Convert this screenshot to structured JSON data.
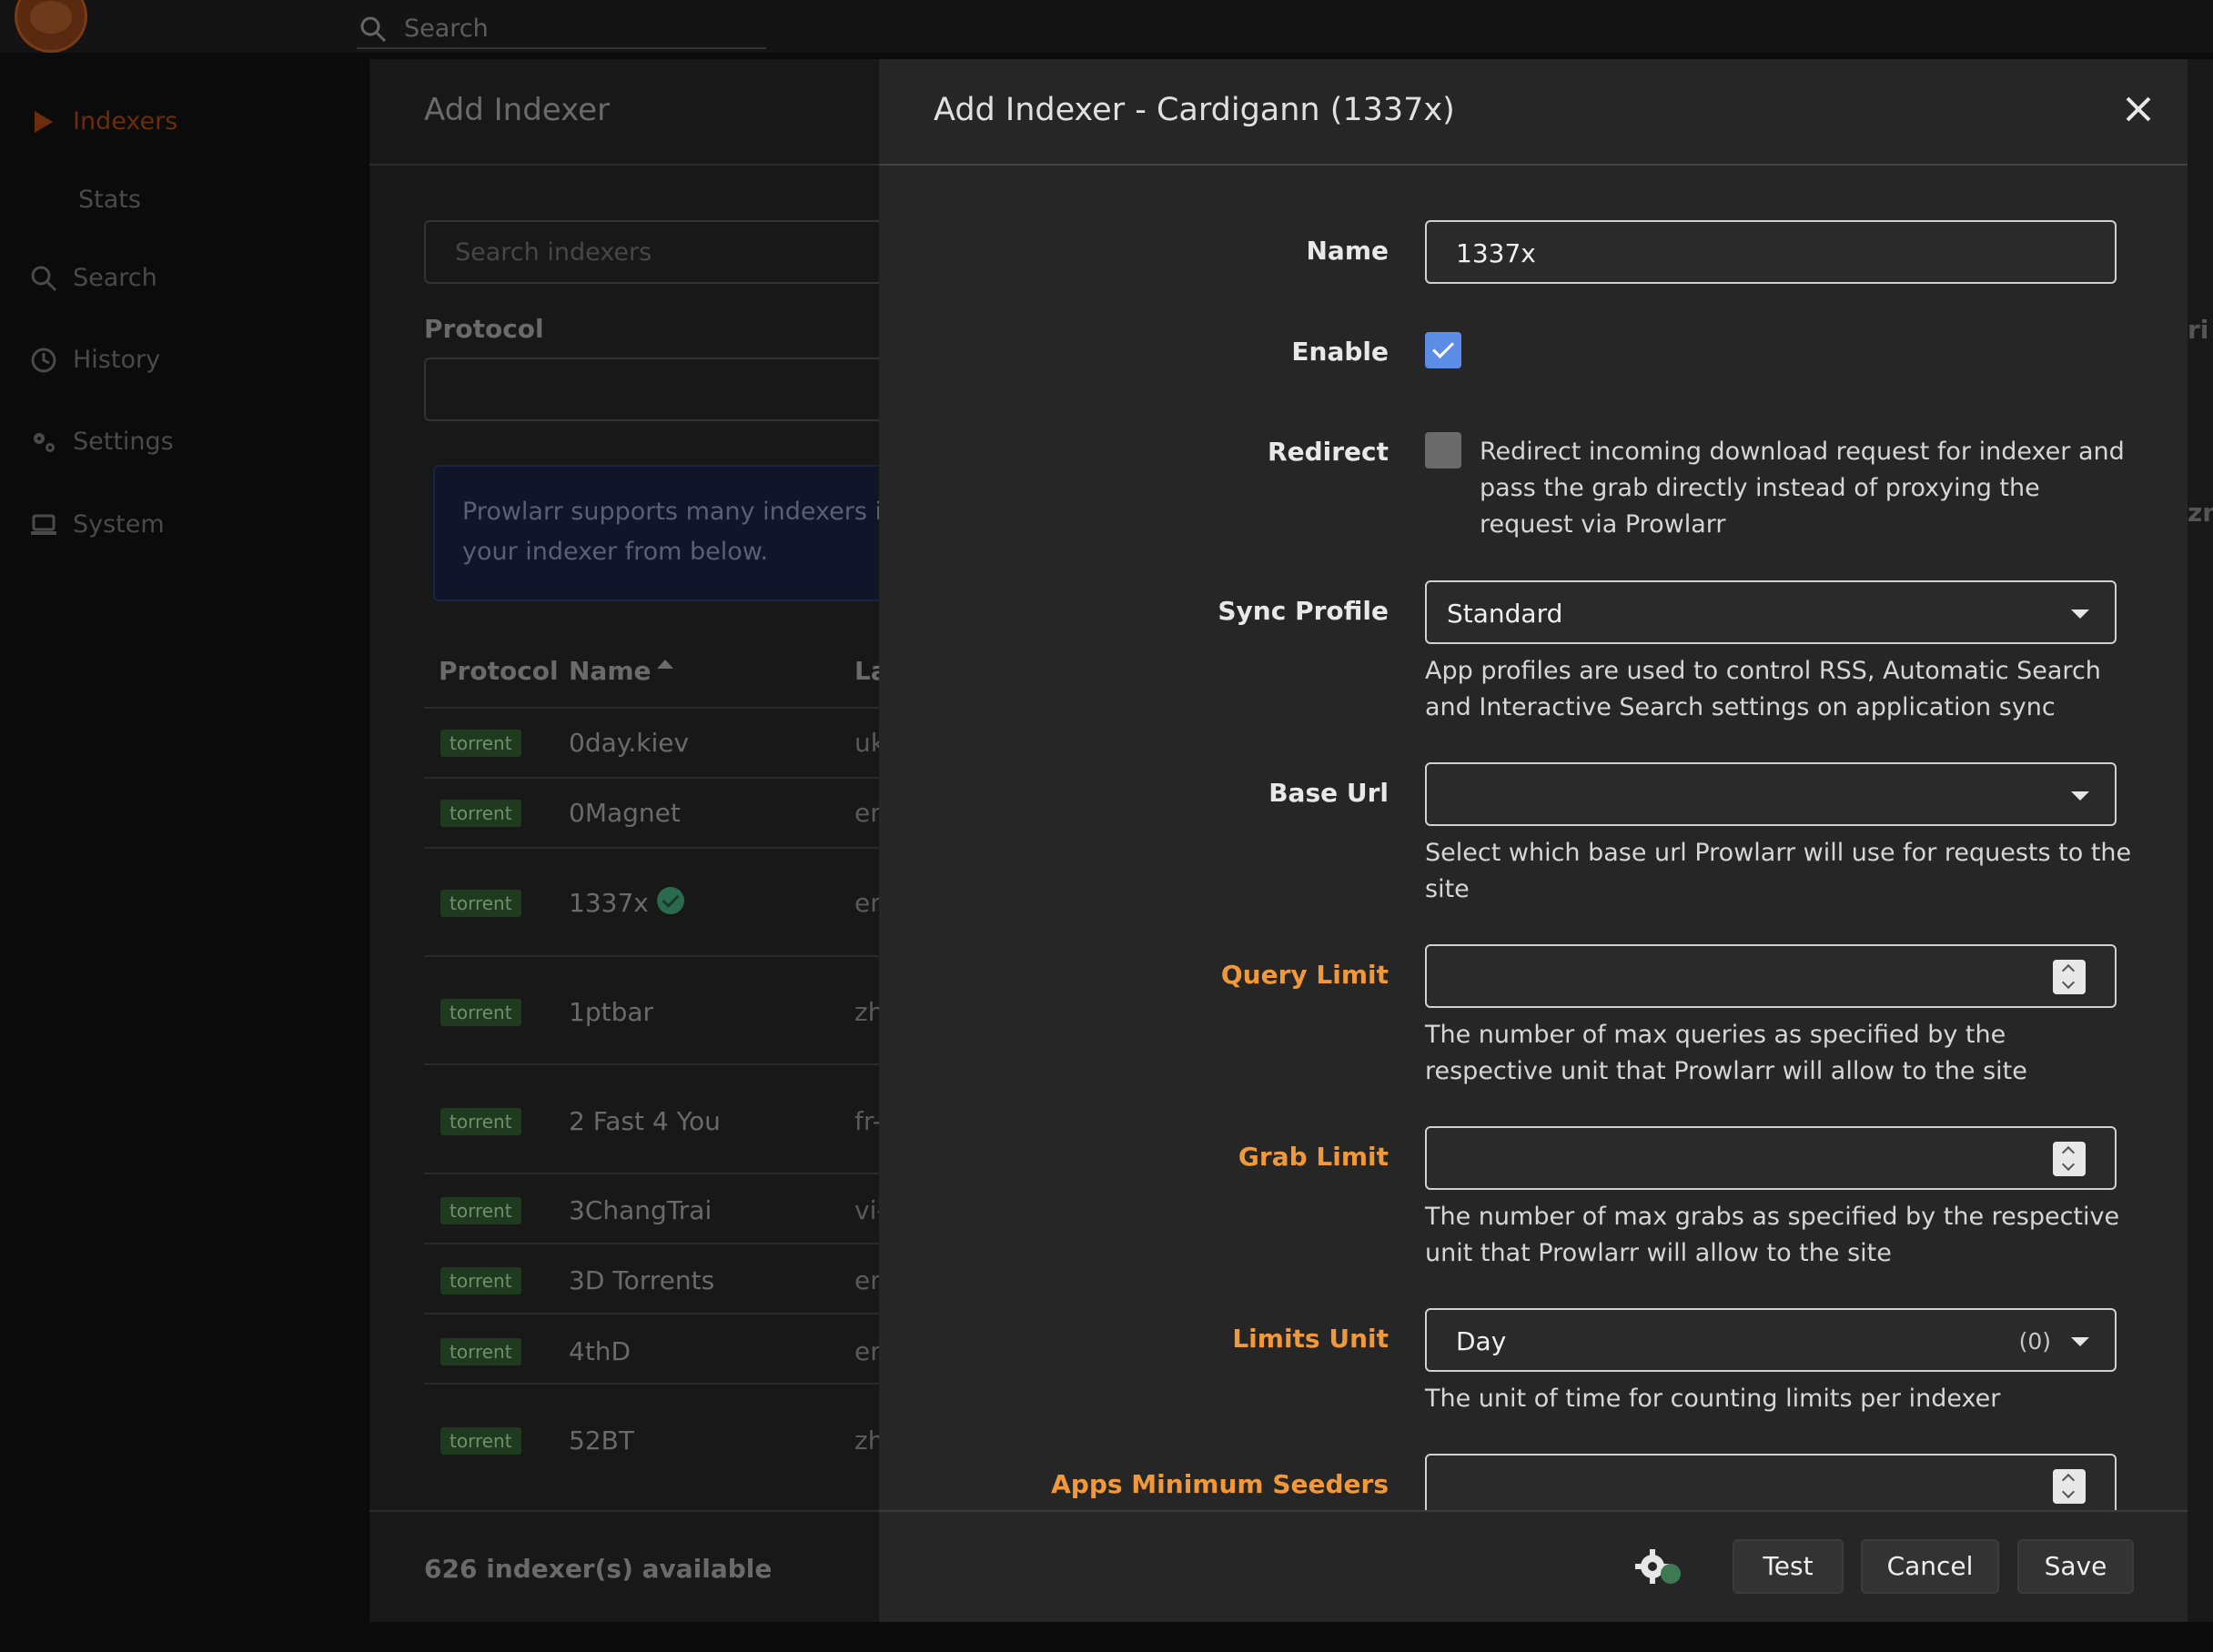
{
  "topbar": {
    "search_placeholder": "Search"
  },
  "sidebar": {
    "items": [
      {
        "label": "Indexers",
        "icon": "play-icon"
      },
      {
        "label": "Stats"
      },
      {
        "label": "Search",
        "icon": "search-icon"
      },
      {
        "label": "History",
        "icon": "history-icon"
      },
      {
        "label": "Settings",
        "icon": "gears-icon"
      },
      {
        "label": "System",
        "icon": "laptop-icon"
      }
    ]
  },
  "background": {
    "title": "Add Indexer",
    "search_placeholder": "Search indexers",
    "protocol_label": "Protocol",
    "info_line1": "Prowlarr supports many indexers in a",
    "info_line2": "your indexer from below.",
    "columns": [
      "Protocol",
      "Name",
      "La"
    ],
    "rows": [
      {
        "protocol": "torrent",
        "name": "0day.kiev",
        "lang": "uk"
      },
      {
        "protocol": "torrent",
        "name": "0Magnet",
        "lang": "en"
      },
      {
        "protocol": "torrent",
        "name": "1337x",
        "lang": "en",
        "selected": true
      },
      {
        "protocol": "torrent",
        "name": "1ptbar",
        "lang": "zh"
      },
      {
        "protocol": "torrent",
        "name": "2 Fast 4 You",
        "lang": "fr-"
      },
      {
        "protocol": "torrent",
        "name": "3ChangTrai",
        "lang": "vi-"
      },
      {
        "protocol": "torrent",
        "name": "3D Torrents",
        "lang": "en"
      },
      {
        "protocol": "torrent",
        "name": "4thD",
        "lang": "en"
      },
      {
        "protocol": "torrent",
        "name": "52BT",
        "lang": "zh"
      }
    ],
    "footer": "626 indexer(s) available",
    "peek_text1": "ri",
    "peek_text2": "zn"
  },
  "modal": {
    "title": "Add Indexer - Cardigann (1337x)",
    "fields": {
      "name": {
        "label": "Name",
        "value": "1337x"
      },
      "enable": {
        "label": "Enable",
        "checked": true
      },
      "redirect": {
        "label": "Redirect",
        "checked": false,
        "help": "Redirect incoming download request for indexer and pass the grab directly instead of proxying the request via Prowlarr"
      },
      "sync_profile": {
        "label": "Sync Profile",
        "value": "Standard",
        "help": "App profiles are used to control RSS, Automatic Search and Interactive Search settings on application sync"
      },
      "base_url": {
        "label": "Base Url",
        "value": "",
        "help": "Select which base url Prowlarr will use for requests to the site"
      },
      "query_limit": {
        "label": "Query Limit",
        "value": "",
        "help": "The number of max queries as specified by the respective unit that Prowlarr will allow to the site"
      },
      "grab_limit": {
        "label": "Grab Limit",
        "value": "",
        "help": "The number of max grabs as specified by the respective unit that Prowlarr will allow to the site"
      },
      "limits_unit": {
        "label": "Limits Unit",
        "value": "Day",
        "count": "(0)",
        "help": "The unit of time for counting limits per indexer"
      },
      "apps_min_seeders": {
        "label": "Apps Minimum Seeders",
        "value": ""
      }
    },
    "buttons": {
      "test": "Test",
      "cancel": "Cancel",
      "save": "Save"
    }
  },
  "colors": {
    "accent_blue": "#5b8de6",
    "warning_orange": "#f0983a",
    "brand_orange": "#6b2d0c"
  }
}
